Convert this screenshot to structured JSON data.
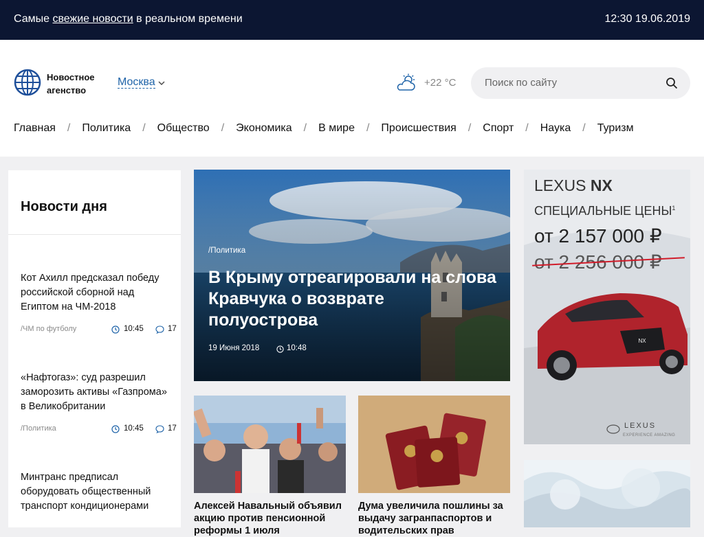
{
  "topbar": {
    "tagline_pre": "Самые ",
    "tagline_link": "свежие новости",
    "tagline_post": " в реальном времени",
    "datetime": "12:30 19.06.2019"
  },
  "header": {
    "logo_text": "Новостное агенство",
    "city": "Москва",
    "weather": "+22 °С",
    "search_placeholder": "Поиск по сайту"
  },
  "nav": [
    "Главная",
    "Политика",
    "Общество",
    "Экономика",
    "В мире",
    "Происшествия",
    "Спорт",
    "Наука",
    "Туризм"
  ],
  "sidebar": {
    "title": "Новости дня",
    "items": [
      {
        "title": "Кот Ахилл предсказал победу российской сборной над Египтом на ЧМ-2018",
        "category": "/ЧМ по футболу",
        "time": "10:45",
        "comments": "17"
      },
      {
        "title": "«Нафтогаз»: суд разрешил заморозить активы «Газпрома» в Великобритании",
        "category": "/Политика",
        "time": "10:45",
        "comments": "17"
      },
      {
        "title": "Минтранс предписал оборудовать общественный транспорт кондиционерами",
        "category": "",
        "time": "",
        "comments": ""
      }
    ]
  },
  "hero": {
    "category": "/Политика",
    "title": "В Крыму отреагировали на слова Кравчука о возврате полуострова",
    "date": "19 Июня 2018",
    "time": "10:48"
  },
  "cards": [
    {
      "title": "Алексей Навальный объявил акцию против пенсионной реформы 1 июля"
    },
    {
      "title": "Дума увеличила пошлины за выдачу загранпаспортов и водительских прав"
    }
  ],
  "ad": {
    "brand": "LEXUS",
    "model": "NX",
    "headline": "СПЕЦИАЛЬНЫЕ ЦЕНЫ",
    "footnote": "1",
    "price_new": "от 2 157 000 ₽",
    "price_old": "от 2 256 000 ₽",
    "plate": "NX",
    "logo": "LEXUS",
    "slogan": "EXPERIENCE AMAZING"
  },
  "colors": {
    "topbar": "#0c1632",
    "link": "#1e63a8",
    "accent": "#1e4f9a"
  }
}
